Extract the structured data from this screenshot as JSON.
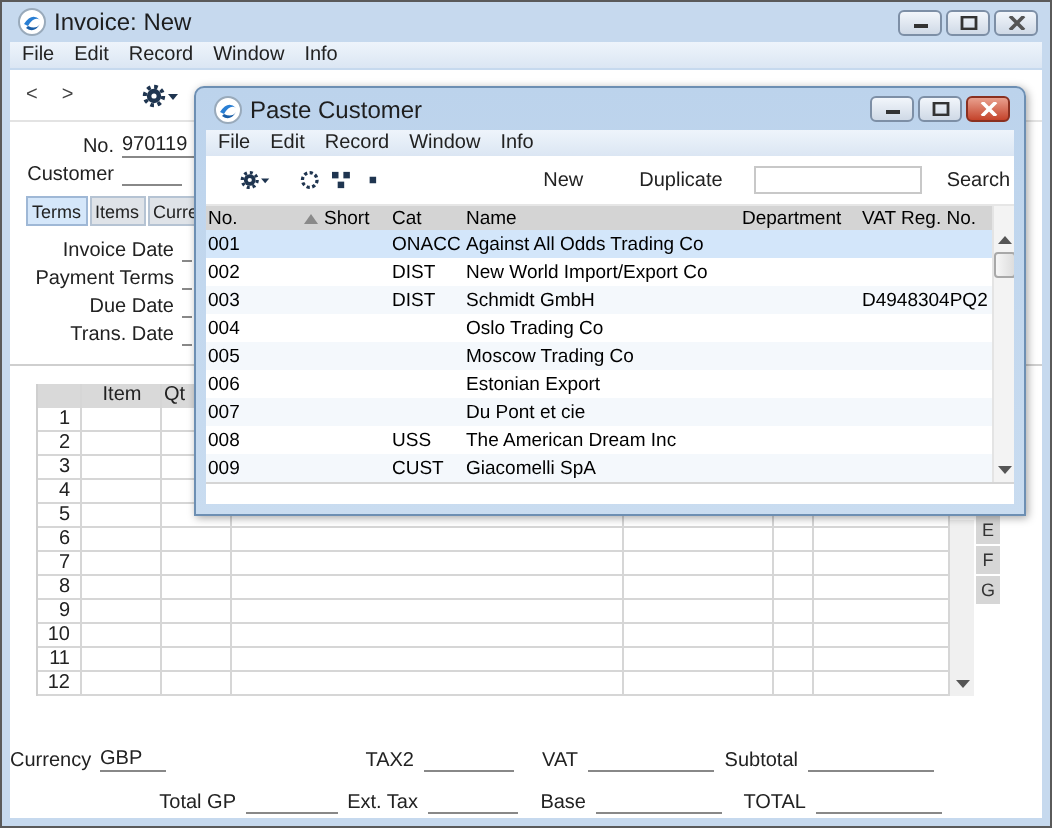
{
  "invoice_window": {
    "title": "Invoice: New",
    "menu": [
      "File",
      "Edit",
      "Record",
      "Window",
      "Info"
    ],
    "nav": [
      "<",
      ">"
    ],
    "header_fields": [
      {
        "label": "No.",
        "value": "970119"
      },
      {
        "label": "Customer"
      }
    ],
    "tabs": [
      {
        "label": "Terms",
        "selected": true
      },
      {
        "label": "Items",
        "selected": false
      },
      {
        "label": "Curre",
        "selected": false
      }
    ],
    "terms_fields": [
      {
        "label": "Invoice Date"
      },
      {
        "label": "Payment Terms"
      },
      {
        "label": "Due Date"
      },
      {
        "label": "Trans. Date"
      }
    ],
    "grid": {
      "columns": [
        "Item",
        "Qt"
      ],
      "line_numbers": [
        "1",
        "2",
        "3",
        "4",
        "5",
        "6",
        "7",
        "8",
        "9",
        "10",
        "11",
        "12"
      ]
    },
    "side_tabs": [
      "E",
      "F",
      "G"
    ],
    "footer": [
      [
        {
          "label": "Currency",
          "value": "GBP"
        },
        {
          "label": "TAX2"
        },
        {
          "label": "VAT"
        },
        {
          "label": "Subtotal"
        }
      ],
      [
        {
          "label": "Total GP"
        },
        {
          "label": "Ext. Tax"
        },
        {
          "label": "Base"
        },
        {
          "label": "TOTAL"
        }
      ]
    ]
  },
  "paste_window": {
    "title": "Paste Customer",
    "menu": [
      "File",
      "Edit",
      "Record",
      "Window",
      "Info"
    ],
    "buttons": [
      "New",
      "Duplicate"
    ],
    "search_button": "Search",
    "columns": [
      {
        "label": "No.",
        "sorted": true
      },
      {
        "label": "Short",
        "sorted": false
      },
      {
        "label": "Cat",
        "sorted": false
      },
      {
        "label": "Name",
        "sorted": false
      },
      {
        "label": "Department",
        "sorted": false
      },
      {
        "label": "VAT Reg. No.",
        "sorted": false
      }
    ],
    "rows": [
      {
        "no": "001",
        "cat": "ONACC",
        "name": "Against All Odds Trading Co",
        "selected": true
      },
      {
        "no": "002",
        "cat": "DIST",
        "name": "New World Import/Export Co",
        "selected": false
      },
      {
        "no": "003",
        "cat": "DIST",
        "name": "Schmidt GmbH",
        "vat_reg_no": "D4948304PQ2",
        "selected": false
      },
      {
        "no": "004",
        "name": "Oslo Trading Co",
        "selected": false
      },
      {
        "no": "005",
        "name": "Moscow Trading Co",
        "selected": false
      },
      {
        "no": "006",
        "name": "Estonian Export",
        "selected": false
      },
      {
        "no": "007",
        "name": "Du Pont et cie",
        "selected": false
      },
      {
        "no": "008",
        "cat": "USS",
        "name": "The American Dream Inc",
        "selected": false
      },
      {
        "no": "009",
        "cat": "CUST",
        "name": "Giacomelli SpA",
        "selected": false
      }
    ]
  }
}
